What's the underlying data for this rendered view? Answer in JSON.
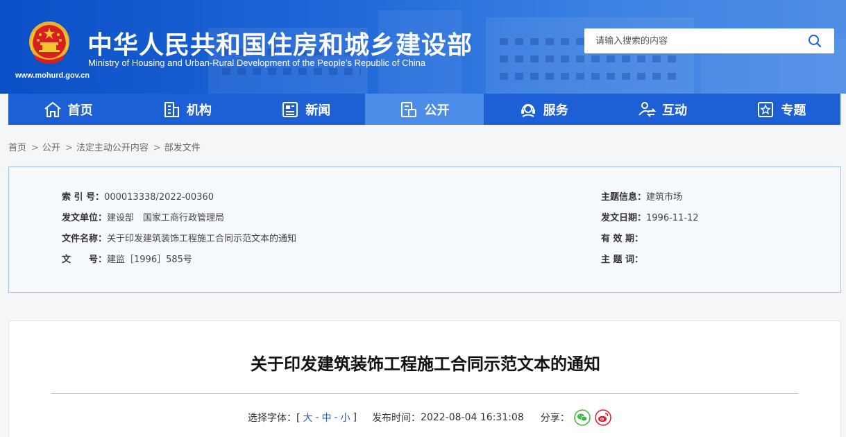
{
  "header": {
    "title": "中华人民共和国住房和城乡建设部",
    "subtitle": "Ministry of Housing and Urban-Rural Development of the People’s Republic of China",
    "url": "www.mohurd.gov.cn",
    "emblem_icon": "national-emblem-icon",
    "search": {
      "placeholder": "请输入搜索的内容",
      "icon": "search-icon"
    }
  },
  "nav": {
    "items": [
      {
        "label": "首页",
        "icon": "home-icon",
        "active": false
      },
      {
        "label": "机构",
        "icon": "building-icon",
        "active": false
      },
      {
        "label": "新闻",
        "icon": "news-icon",
        "active": false
      },
      {
        "label": "公开",
        "icon": "disclosure-icon",
        "active": true
      },
      {
        "label": "服务",
        "icon": "service-icon",
        "active": false
      },
      {
        "label": "互动",
        "icon": "interaction-icon",
        "active": false
      },
      {
        "label": "专题",
        "icon": "topic-icon",
        "active": false
      }
    ]
  },
  "breadcrumb": {
    "items": [
      "首页",
      "公开",
      "法定主动公开内容",
      "部发文件"
    ],
    "separator": ">"
  },
  "meta": {
    "index_label": "索 引 号：",
    "index_value": "000013338/2022-00360",
    "issuer_label": "发文单位：",
    "issuer_value": "建设部　国家工商行政管理局",
    "doc_name_label": "文件名称：",
    "doc_name_value": "关于印发建筑装饰工程施工合同示范文本的通知",
    "doc_no_label": "文　　号：",
    "doc_no_value": "建监［1996］585号",
    "topic_label": "主题信息：",
    "topic_value": "建筑市场",
    "date_label": "发文日期：",
    "date_value": "1996-11-12",
    "validity_label": "有 效 期：",
    "validity_value": "",
    "keywords_label": "主 题 词：",
    "keywords_value": ""
  },
  "article": {
    "title": "关于印发建筑装饰工程施工合同示范文本的通知",
    "font_size_label": "选择字体：[",
    "font_large": "大",
    "font_medium": "中",
    "font_small": "小",
    "font_size_close": "]",
    "publish_label": "发布时间：",
    "publish_time": "2022-08-04 16:31:08",
    "share_label": "分享：",
    "share_icons": [
      "wechat-icon",
      "weibo-icon"
    ]
  },
  "colors": {
    "header_blue": "#0b4fc6",
    "nav_blue": "#1d5fd4",
    "nav_active": "#4b8de8",
    "wechat_green": "#3db33a",
    "weibo_red": "#e6162d"
  }
}
